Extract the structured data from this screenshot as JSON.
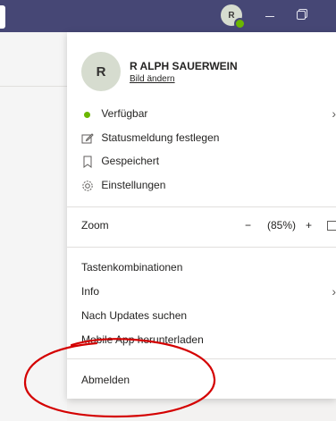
{
  "titlebar": {
    "avatar_initial": "R",
    "status_color": "#6bb700",
    "minimize_icon": "minimize-icon",
    "restore_icon": "restore-icon"
  },
  "profile": {
    "avatar_initial": "R",
    "name": "R ALPH SAUERWEIN",
    "change_picture": "Bild ändern"
  },
  "menu": {
    "status": "Verfügbar",
    "status_message": "Statusmeldung festlegen",
    "saved": "Gespeichert",
    "settings": "Einstellungen",
    "zoom_label": "Zoom",
    "zoom_minus": "−",
    "zoom_value": "(85%)",
    "zoom_plus": "+",
    "shortcuts": "Tastenkombinationen",
    "info": "Info",
    "check_updates": "Nach Updates suchen",
    "mobile_app": "Mobile App herunterladen",
    "sign_out": "Abmelden"
  },
  "colors": {
    "titlebar": "#464775",
    "available": "#6bb700",
    "annotation": "#d40000"
  }
}
